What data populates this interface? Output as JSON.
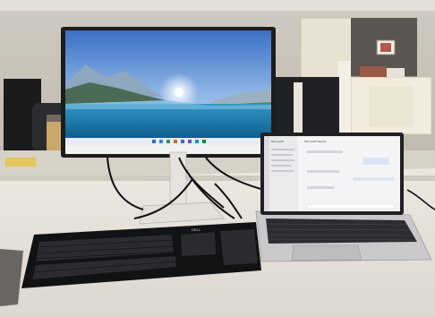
{
  "scene": {
    "keyboard_brand": "DELL",
    "laptop_app": {
      "sidebar_heading": "Microsoft",
      "chat_title": "Microsoft Teams"
    }
  },
  "colors": {
    "wall": "#d8d4cc",
    "desk": "#e6e3dc",
    "cabinet": "#efe9dc",
    "monitor_bezel": "#1c1c1e",
    "sky_top": "#3f74c7",
    "lake": "#1f7bb0",
    "keyboard": "#111214"
  }
}
